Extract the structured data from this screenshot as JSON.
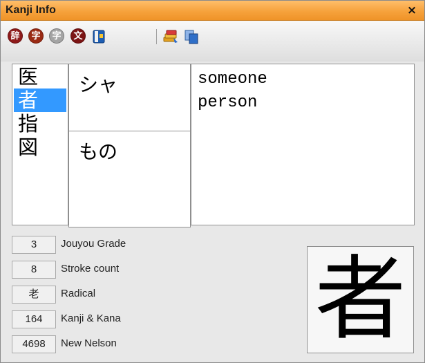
{
  "window": {
    "title": "Kanji Info",
    "close_glyph": "×"
  },
  "toolbar": {
    "buttons": [
      {
        "icon": "dictionary-icon",
        "glyph": "辞",
        "color": "#8e1a1a"
      },
      {
        "icon": "character-icon",
        "glyph": "字",
        "color": "#9a2a14"
      },
      {
        "icon": "character-disabled-icon",
        "glyph": "字",
        "color": "#9a9a9a"
      },
      {
        "icon": "text-icon",
        "glyph": "文",
        "color": "#7c1414"
      },
      {
        "icon": "book-icon",
        "glyph": "",
        "color": "#1e5fb4"
      },
      {
        "icon": "stack-icon",
        "glyph": "",
        "color": "#e2a020"
      },
      {
        "icon": "copy-icon",
        "glyph": "",
        "color": "#2f6fc8"
      }
    ]
  },
  "kanji_list": {
    "items": [
      "医",
      "者",
      "指",
      "図"
    ],
    "selected_index": 1,
    "selection_color": "#3399ff"
  },
  "readings": {
    "on": "シャ",
    "kun": "もの"
  },
  "meanings": [
    "someone",
    "person"
  ],
  "info": [
    {
      "value": "3",
      "label": "Jouyou Grade"
    },
    {
      "value": "8",
      "label": "Stroke count"
    },
    {
      "value": "老",
      "label": "Radical"
    },
    {
      "value": "164",
      "label": "Kanji & Kana"
    },
    {
      "value": "4698",
      "label": "New Nelson"
    }
  ],
  "big_kanji": "者",
  "colors": {
    "title_bar": "#f6a23c"
  }
}
